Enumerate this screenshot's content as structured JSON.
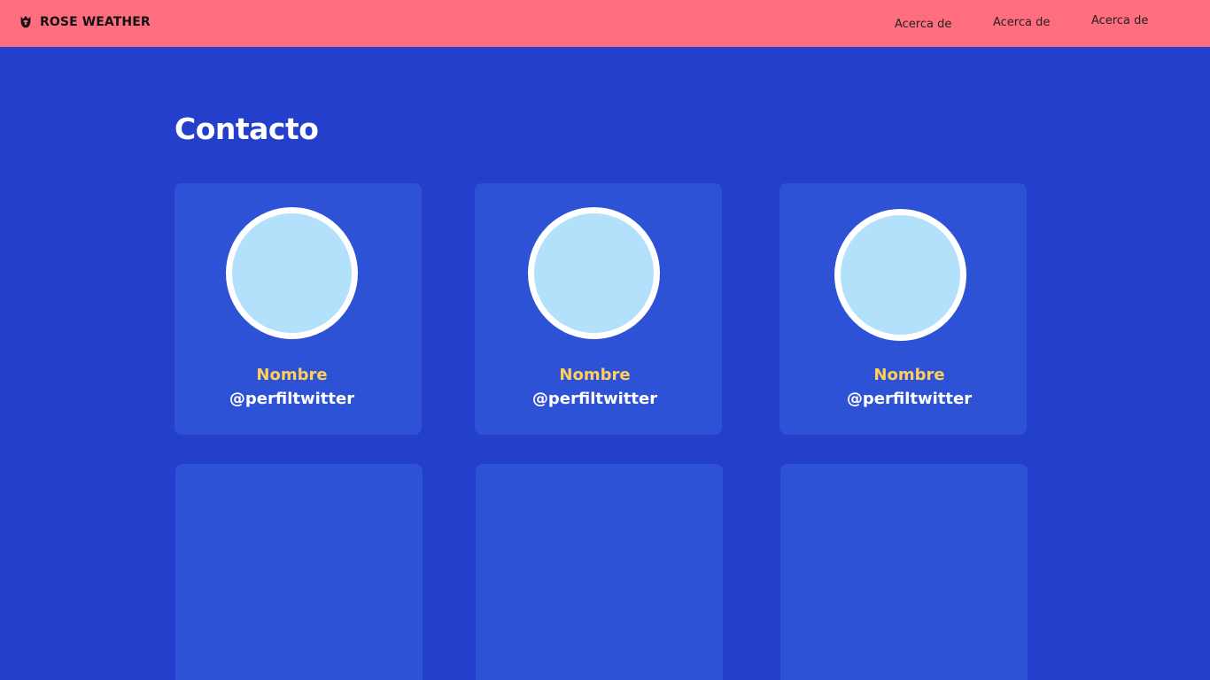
{
  "header": {
    "brand": "ROSE WEATHER",
    "brand_icon": "rose-icon",
    "nav": [
      {
        "label": "Acerca de"
      },
      {
        "label": "Acerca de"
      },
      {
        "label": "Acerca de"
      }
    ]
  },
  "main": {
    "title": "Contacto",
    "contacts": [
      {
        "name": "Nombre",
        "handle": "@perfiltwitter"
      },
      {
        "name": "Nombre",
        "handle": "@perfiltwitter"
      },
      {
        "name": "Nombre",
        "handle": "@perfiltwitter"
      }
    ]
  },
  "colors": {
    "header_bg": "#ff6e7f",
    "page_bg": "#233fcb",
    "card_bg": "#2e52d5",
    "avatar_fill": "#b3e0fb",
    "name_color": "#ffcf5a",
    "handle_color": "#ffffff"
  }
}
